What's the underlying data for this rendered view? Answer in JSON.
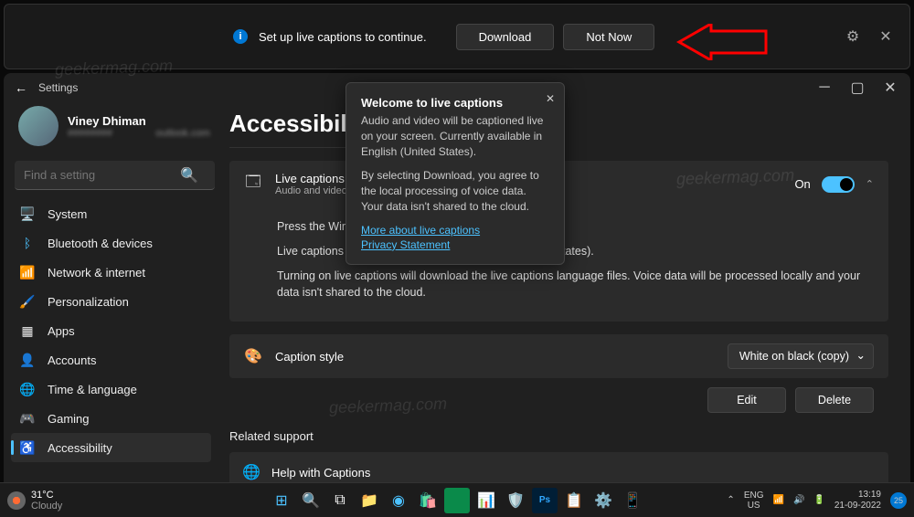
{
  "notification": {
    "message": "Set up live captions to continue.",
    "download_label": "Download",
    "notnow_label": "Not Now"
  },
  "window": {
    "title": "Settings",
    "profile_name": "Viney Dhiman",
    "profile_email": "########outlook.com",
    "search_placeholder": "Find a setting"
  },
  "sidebar": {
    "items": [
      {
        "icon": "🖥️",
        "label": "System"
      },
      {
        "icon": "ᛒ",
        "label": "Bluetooth & devices",
        "color": "#4cc2ff"
      },
      {
        "icon": "📶",
        "label": "Network & internet",
        "color": "#4cc2ff"
      },
      {
        "icon": "🖌️",
        "label": "Personalization"
      },
      {
        "icon": "▦",
        "label": "Apps"
      },
      {
        "icon": "👤",
        "label": "Accounts"
      },
      {
        "icon": "🌐",
        "label": "Time & language"
      },
      {
        "icon": "🎮",
        "label": "Gaming"
      },
      {
        "icon": "♿",
        "label": "Accessibility",
        "active": true,
        "color": "#4cc2ff"
      }
    ]
  },
  "main": {
    "title": "Accessibility",
    "live_captions": {
      "title": "Live captions",
      "subtitle": "Audio and video w",
      "state_label": "On",
      "line1": "Press the Windo",
      "line2": "Live captions are currently available in English (United States).",
      "line3": "Turning on live captions will download the live captions language files. Voice data will be processed locally and your data isn't shared to the cloud."
    },
    "caption_style": {
      "title": "Caption style",
      "selected": "White on black (copy)",
      "edit_label": "Edit",
      "delete_label": "Delete"
    },
    "related_label": "Related support",
    "help_label": "Help with Captions"
  },
  "tooltip": {
    "title": "Welcome to live captions",
    "p1": "Audio and video will be captioned live on your screen. Currently available in English (United States).",
    "p2": "By selecting Download, you agree to the local processing of voice data. Your data isn't shared to the cloud.",
    "link1": "More about live captions",
    "link2": "Privacy Statement"
  },
  "taskbar": {
    "temp": "31°C",
    "weather": "Cloudy",
    "lang1": "ENG",
    "lang2": "US",
    "time": "13:19",
    "date": "21-09-2022",
    "badge": "25"
  }
}
